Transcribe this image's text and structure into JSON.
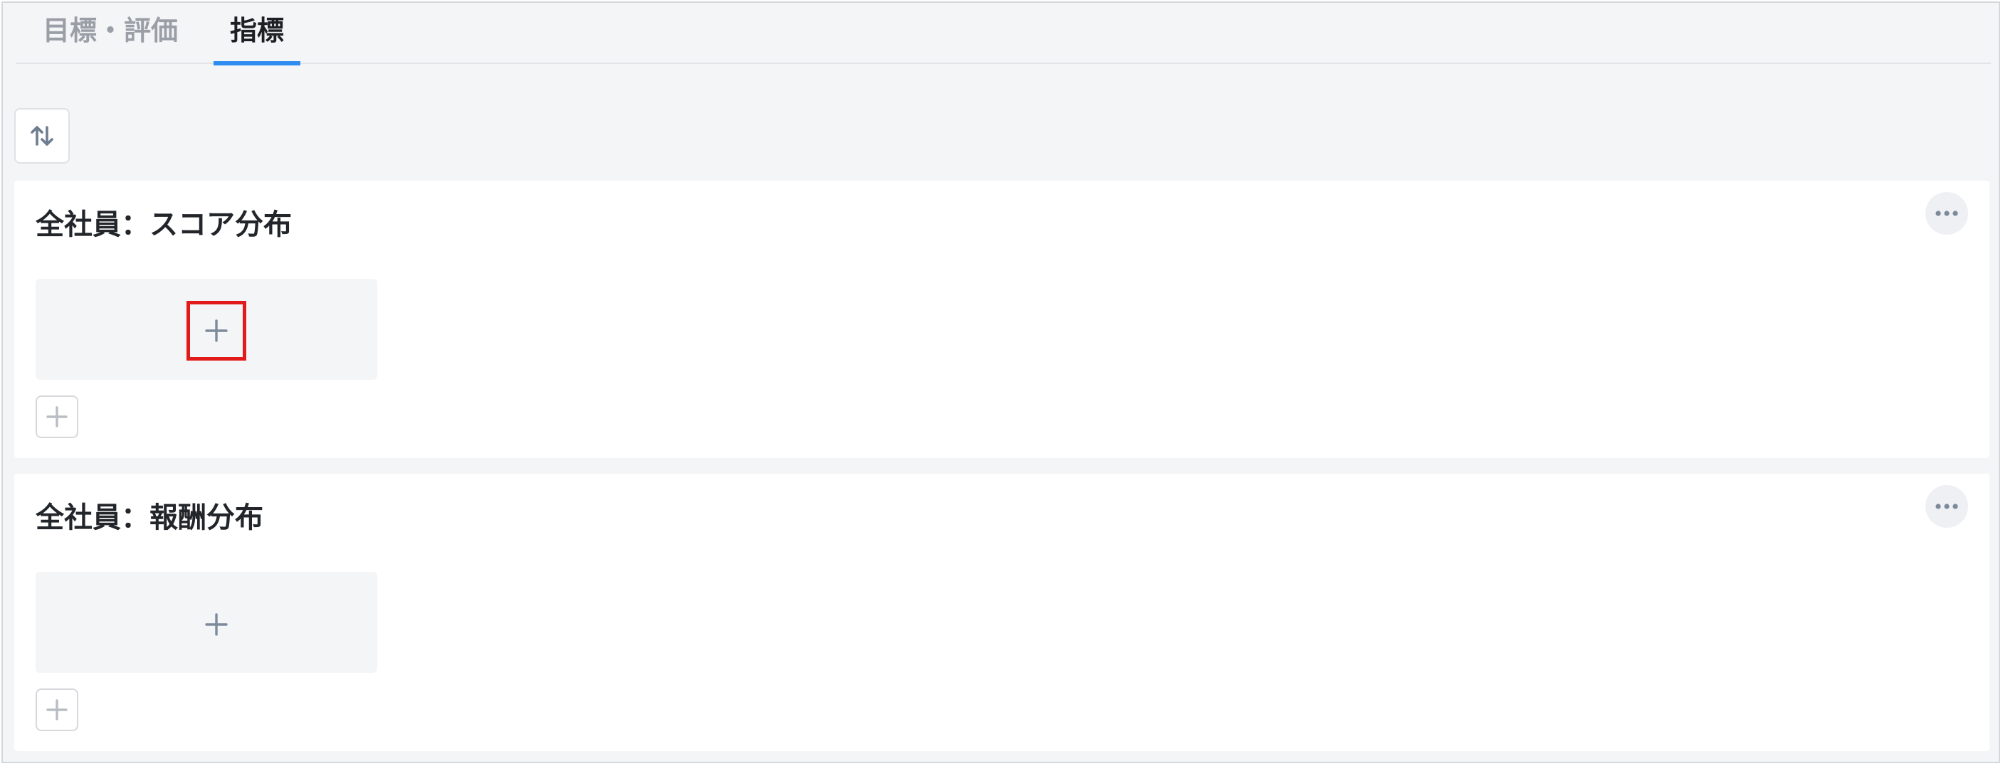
{
  "tabs": [
    {
      "label": "目標・評価"
    },
    {
      "label": "指標",
      "active": true
    }
  ],
  "toolbar": {
    "sort_icon": "sort-arrows-icon"
  },
  "cards": [
    {
      "title": "全社員：スコア分布",
      "add_icon": "plus-icon",
      "more_icon": "ellipsis-icon"
    },
    {
      "title": "全社員：報酬分布",
      "add_icon": "plus-icon",
      "more_icon": "ellipsis-icon"
    }
  ],
  "colors": {
    "accent": "#2f8cf0",
    "highlight": "#e11a1a",
    "icon": "#7d8a9c",
    "background": "#f4f5f7"
  }
}
